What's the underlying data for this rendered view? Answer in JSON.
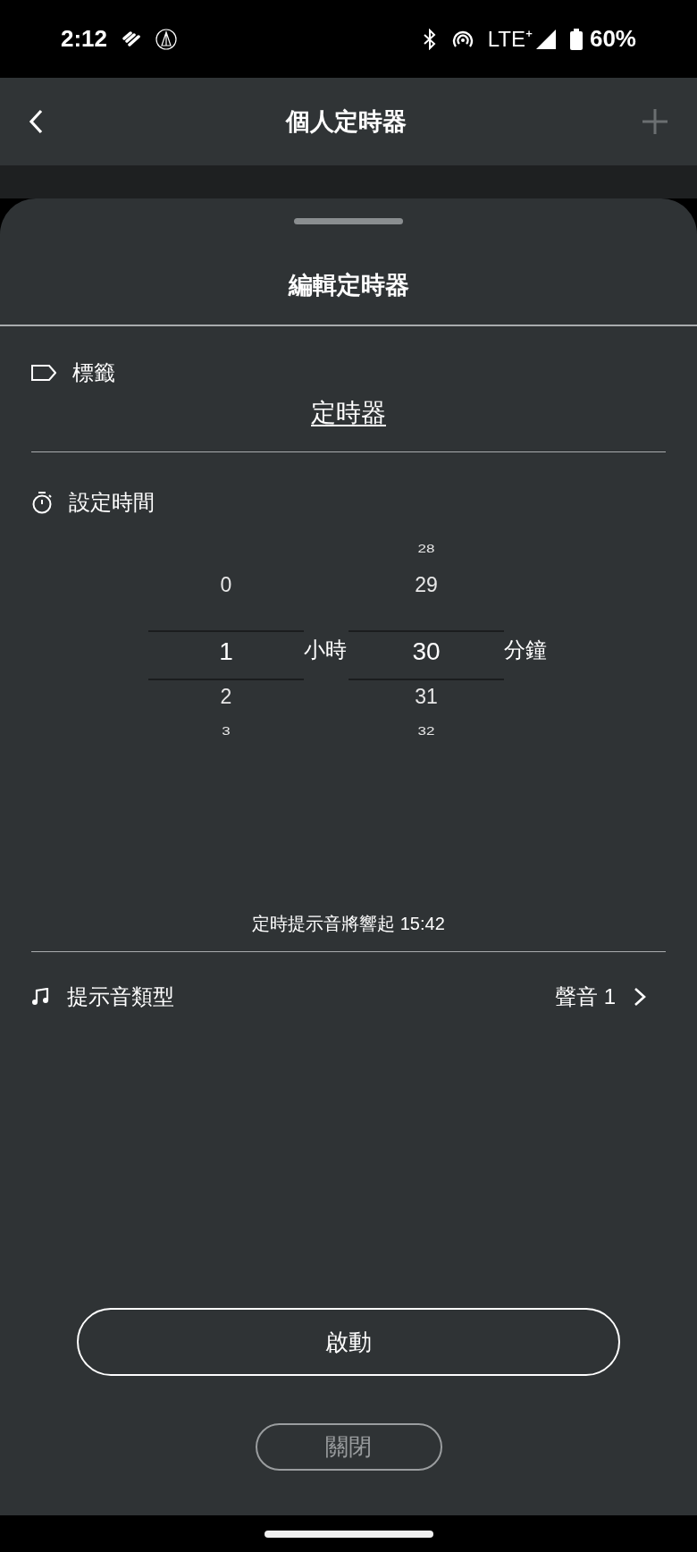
{
  "status_bar": {
    "time": "2:12",
    "network": "LTE⁺",
    "battery": "60%"
  },
  "app_bar": {
    "title": "個人定時器"
  },
  "sheet": {
    "title": "編輯定時器",
    "label_row": {
      "label": "標籤",
      "value": "定時器"
    },
    "time_row": {
      "label": "設定時間"
    },
    "picker": {
      "columns": [
        {
          "unit": "小時",
          "items": [
            {
              "text": "0",
              "selected": false
            },
            {
              "text": "1",
              "selected": true
            },
            {
              "text": "2",
              "selected": false
            },
            {
              "text": "3",
              "selected": false
            }
          ]
        },
        {
          "unit": "分鐘",
          "items": [
            {
              "text": "28",
              "selected": false
            },
            {
              "text": "29",
              "selected": false
            },
            {
              "text": "30",
              "selected": true
            },
            {
              "text": "31",
              "selected": false
            },
            {
              "text": "32",
              "selected": false
            }
          ]
        }
      ]
    },
    "alarm_note": "定時提示音將響起 15:42",
    "sound_row": {
      "label": "提示音類型",
      "value": "聲音 1"
    },
    "buttons": [
      {
        "label": "啟動",
        "disabled": false
      },
      {
        "label": "關閉",
        "disabled": true
      }
    ]
  }
}
